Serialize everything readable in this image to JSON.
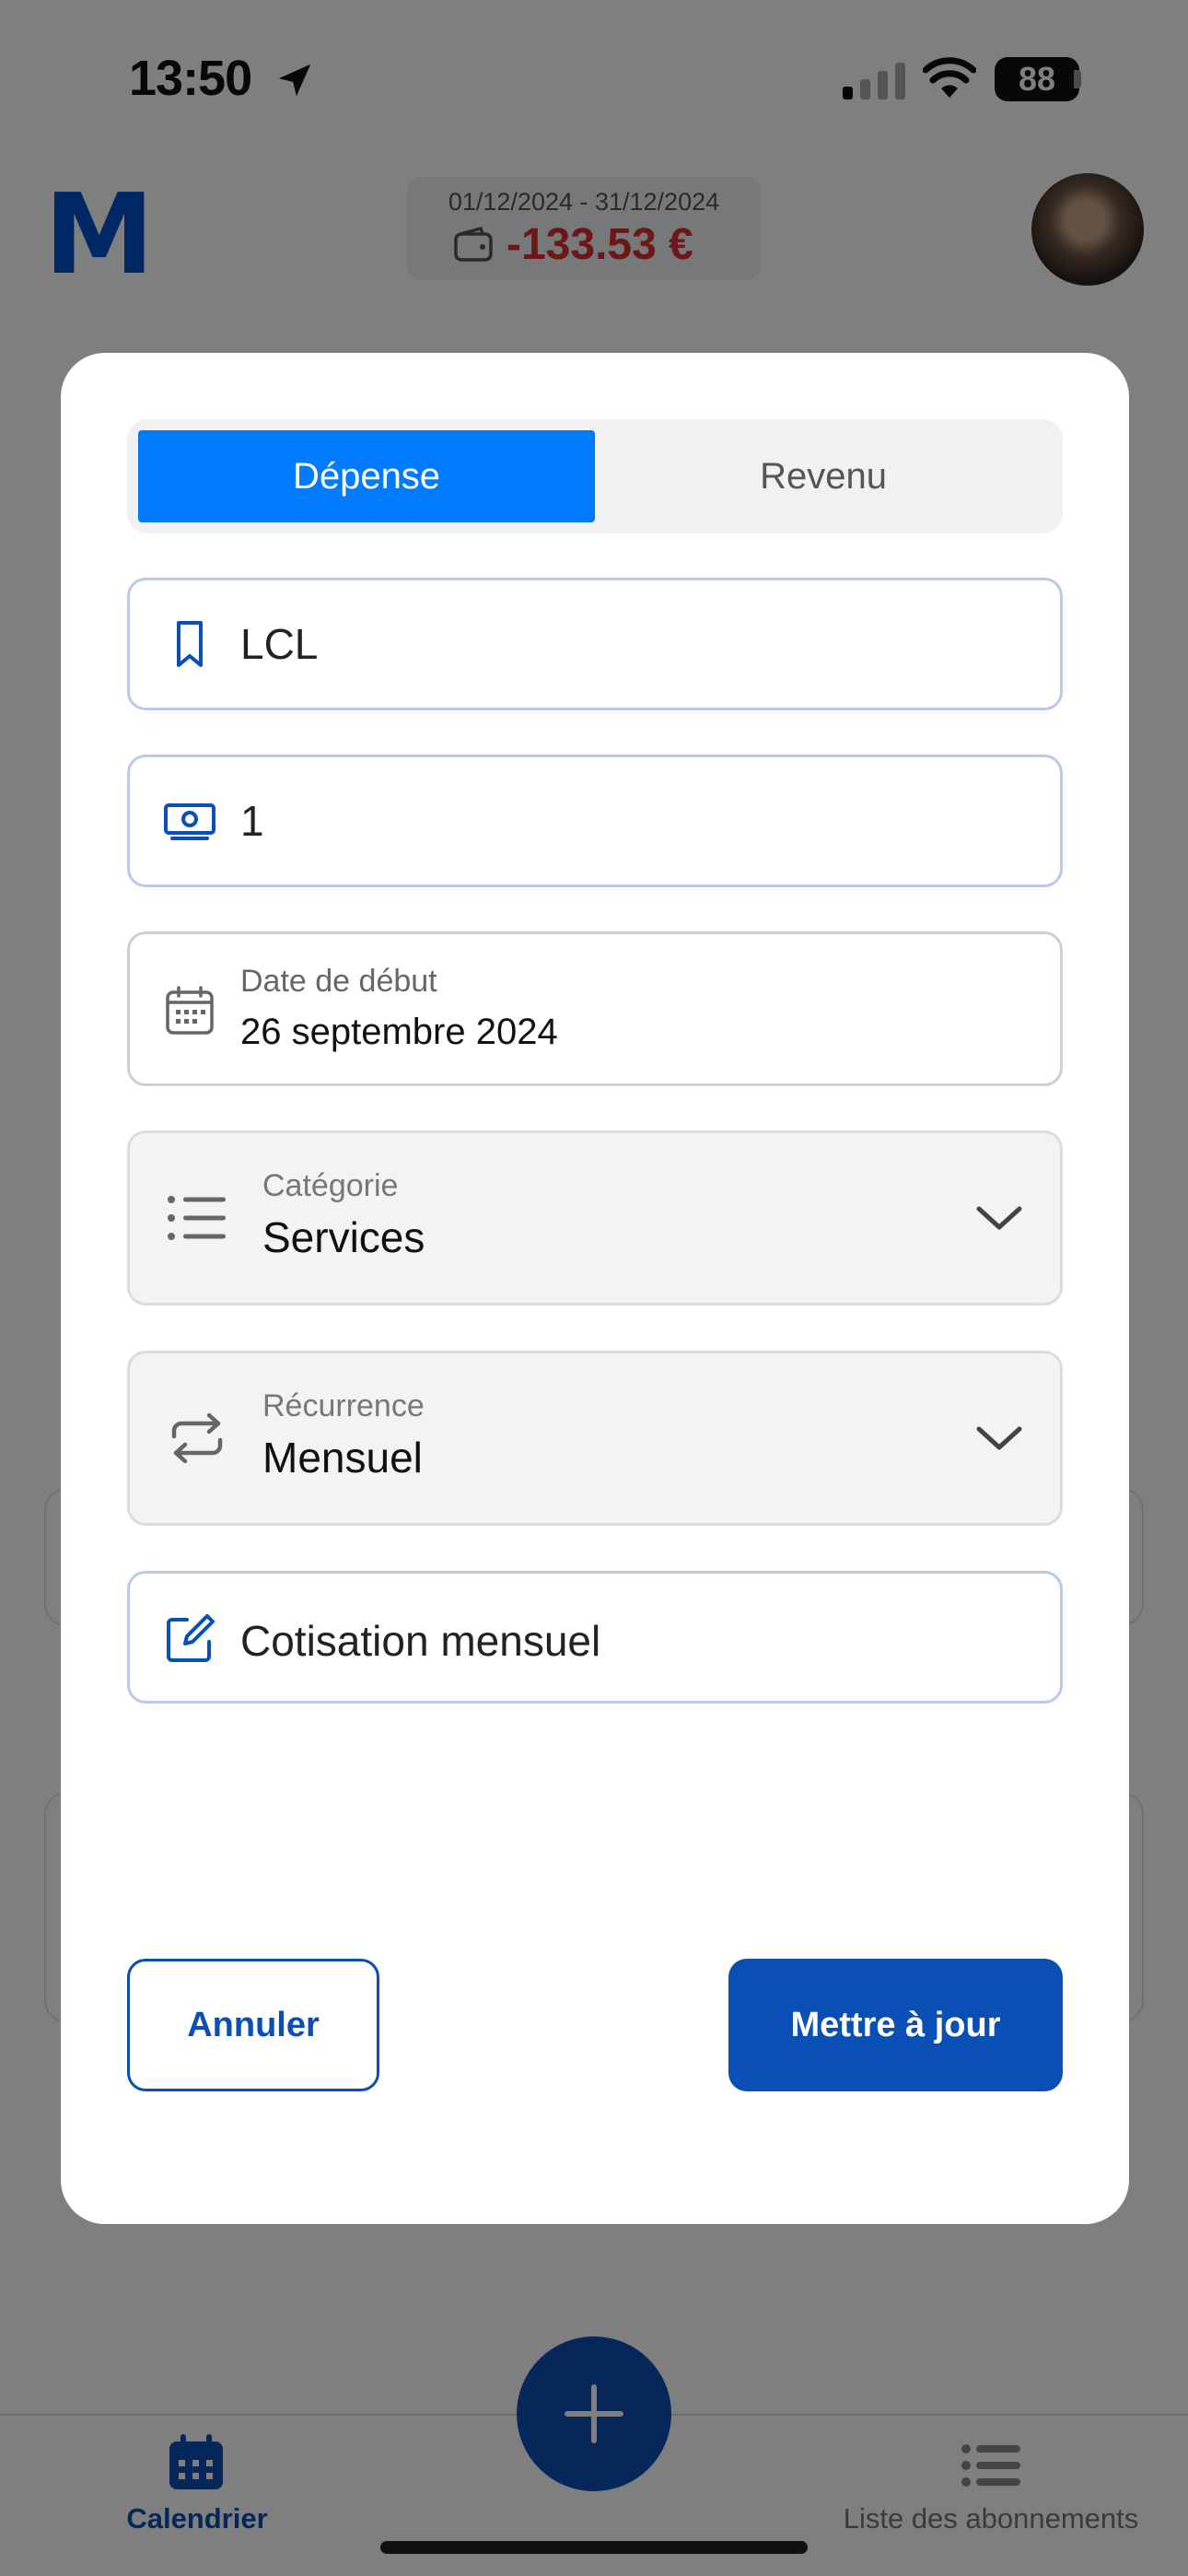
{
  "status_bar": {
    "time": "13:50",
    "battery": "88"
  },
  "header": {
    "logo": "M",
    "period": "01/12/2024 - 31/12/2024",
    "balance": "-133.53 €"
  },
  "modal": {
    "tabs": {
      "expense": "Dépense",
      "income": "Revenu",
      "selected": "expense"
    },
    "name_value": "LCL",
    "amount_value": "1",
    "start_date": {
      "label": "Date de début",
      "value": "26 septembre 2024"
    },
    "category": {
      "label": "Catégorie",
      "value": "Services"
    },
    "recurrence": {
      "label": "Récurrence",
      "value": "Mensuel"
    },
    "note_value": "Cotisation mensuel",
    "cancel_label": "Annuler",
    "update_label": "Mettre à jour"
  },
  "bottom_nav": {
    "calendar_label": "Calendrier",
    "subscriptions_label": "Liste des abonnements"
  },
  "colors": {
    "primary": "#0a4fb5",
    "active_tab": "#007bff",
    "negative": "#d93030"
  }
}
